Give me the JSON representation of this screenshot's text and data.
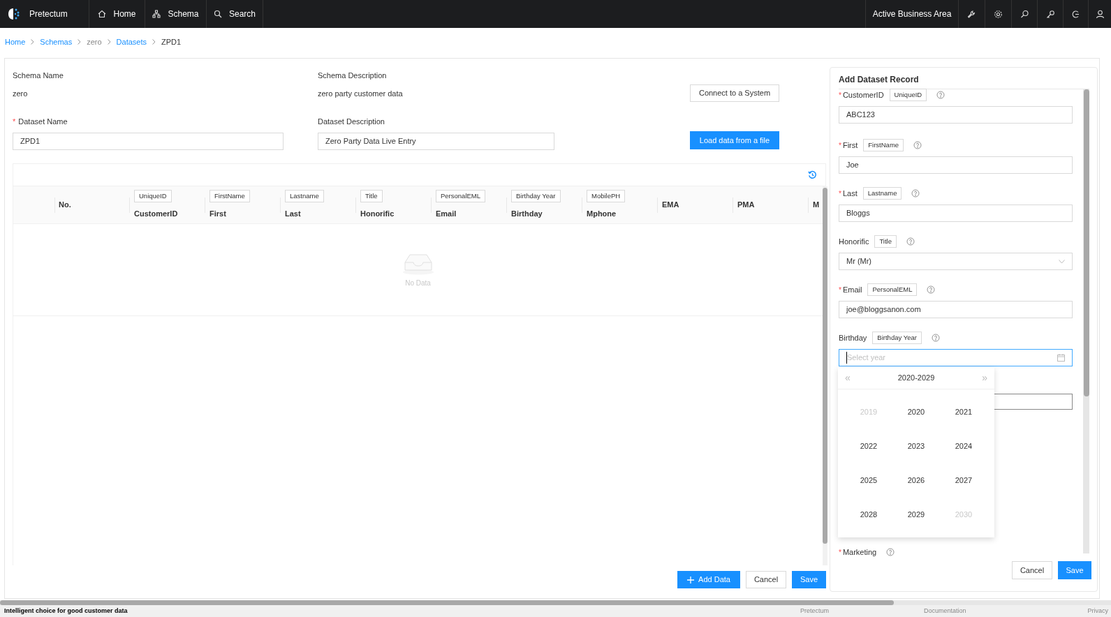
{
  "app": {
    "name": "Pretectum"
  },
  "nav": [
    {
      "label": "Home",
      "kind": "home"
    },
    {
      "label": "Schema",
      "kind": "schema"
    },
    {
      "label": "Search",
      "kind": "search"
    }
  ],
  "business_area": "Active Business Area",
  "breadcrumb": [
    {
      "label": "Home",
      "link": true
    },
    {
      "label": "Schemas",
      "link": true
    },
    {
      "label": "zero",
      "link": false
    },
    {
      "label": "Datasets",
      "link": true
    },
    {
      "label": "ZPD1",
      "link": false
    }
  ],
  "schema": {
    "name_label": "Schema Name",
    "name": "zero",
    "description_label": "Schema Description",
    "description": "zero party customer data"
  },
  "dataset": {
    "name_label": "Dataset Name",
    "name_required_mark": "*",
    "name": "ZPD1",
    "description_label": "Dataset Description",
    "description": "Zero Party Data Live Entry"
  },
  "buttons_top": [
    "Connect to a System",
    "Load data from a file"
  ],
  "table": {
    "columns": [
      {
        "label": "No."
      },
      {
        "tag": "UniqueID",
        "label": "CustomerID"
      },
      {
        "tag": "FirstName",
        "label": "First"
      },
      {
        "tag": "Lastname",
        "label": "Last"
      },
      {
        "tag": "Title",
        "label": "Honorific"
      },
      {
        "tag": "PersonalEML",
        "label": "Email"
      },
      {
        "tag": "Birthday Year",
        "label": "Birthday"
      },
      {
        "tag": "MobilePH",
        "label": "Mphone"
      },
      {
        "label": "EMA"
      },
      {
        "label": "PMA"
      },
      {
        "label": "M"
      }
    ],
    "empty_text": "No Data"
  },
  "buttons_bottom": [
    "Add Data",
    "Cancel",
    "Save"
  ],
  "record_panel": {
    "title": "Add Dataset Record",
    "fields": [
      {
        "kind": "input",
        "required_mark": "*",
        "label": "CustomerID",
        "tag": "UniqueID",
        "value": "ABC123"
      },
      {
        "kind": "input",
        "required_mark": "*",
        "label": "First",
        "tag": "FirstName",
        "value": "Joe"
      },
      {
        "kind": "input",
        "required_mark": "*",
        "label": "Last",
        "tag": "Lastname",
        "value": "Bloggs"
      },
      {
        "kind": "select",
        "label": "Honorific",
        "tag": "Title",
        "value": "Mr (Mr)"
      },
      {
        "kind": "input",
        "required_mark": "*",
        "label": "Email",
        "tag": "PersonalEML",
        "value": "joe@bloggsanon.com"
      },
      {
        "kind": "year",
        "label": "Birthday",
        "tag": "Birthday Year",
        "placeholder": "Select year"
      },
      {
        "kind": "covered"
      },
      {
        "kind": "label_only",
        "required_mark": "*",
        "label": "Marketing"
      }
    ],
    "buttons": [
      "Cancel",
      "Save"
    ]
  },
  "year_picker": {
    "range": "2020-2029",
    "prev": "«",
    "next": "»",
    "years": [
      {
        "label": "2019",
        "muted": true
      },
      {
        "label": "2020",
        "muted": false
      },
      {
        "label": "2021",
        "muted": false
      },
      {
        "label": "2022",
        "muted": false
      },
      {
        "label": "2023",
        "muted": false
      },
      {
        "label": "2024",
        "muted": false
      },
      {
        "label": "2025",
        "muted": false
      },
      {
        "label": "2026",
        "muted": false
      },
      {
        "label": "2027",
        "muted": false
      },
      {
        "label": "2028",
        "muted": false
      },
      {
        "label": "2029",
        "muted": false
      },
      {
        "label": "2030",
        "muted": true
      }
    ]
  },
  "footer": {
    "tagline": "Intelligent choice for good customer data",
    "links": [
      "Pretectum",
      "Documentation",
      "Privacy"
    ]
  }
}
